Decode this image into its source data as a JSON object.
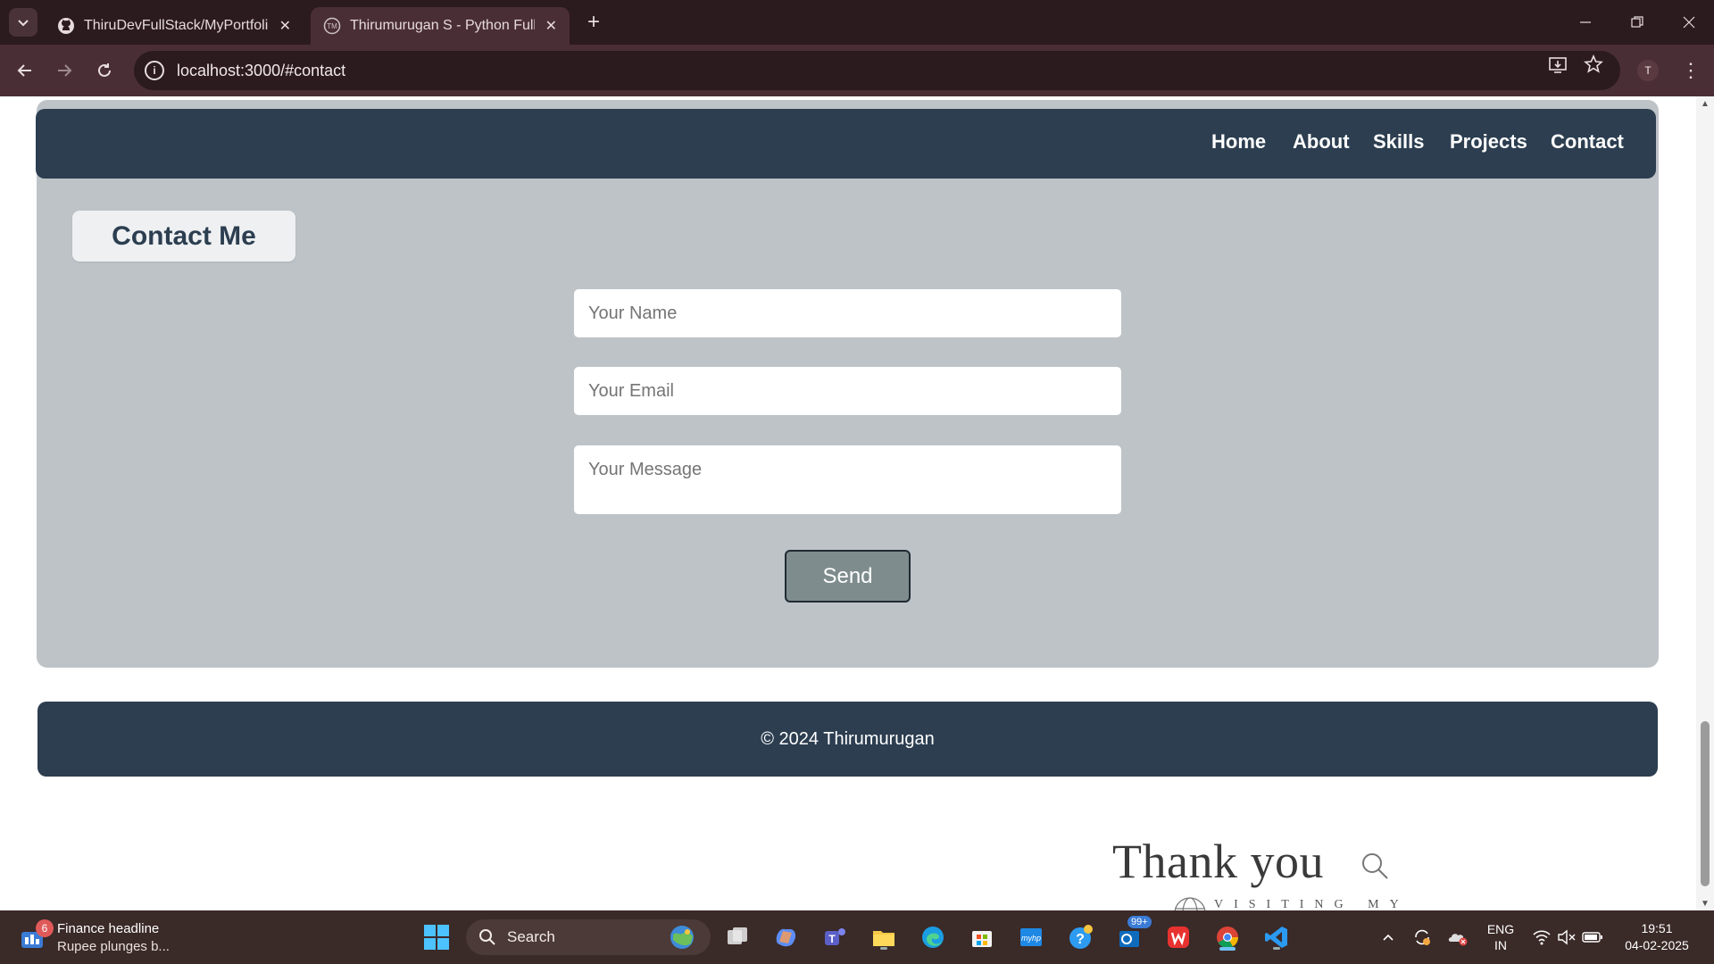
{
  "browser": {
    "tabs": [
      {
        "title": "ThiruDevFullStack/MyPortfolio-",
        "active": false
      },
      {
        "title": "Thirumurugan S - Python FullSt",
        "active": true
      }
    ],
    "url": "localhost:3000/#contact",
    "profile_initial": "T"
  },
  "navbar": {
    "links": [
      "Home",
      "About",
      "Skills",
      "Projects",
      "Contact"
    ]
  },
  "contact": {
    "heading": "Contact Me",
    "name_placeholder": "Your Name",
    "email_placeholder": "Your Email",
    "message_placeholder": "Your Message",
    "send_label": "Send"
  },
  "footer": {
    "text": "© 2024 Thirumurugan"
  },
  "bottom_image": {
    "thank_you": "Thank you",
    "visiting": "VISITING MY"
  },
  "taskbar": {
    "widget_title": "Finance headline",
    "widget_sub": "Rupee plunges b...",
    "widget_badge": "6",
    "search_label": "Search",
    "outlook_badge": "99+",
    "lang_top": "ENG",
    "lang_bottom": "IN",
    "time": "19:51",
    "date": "04-02-2025"
  },
  "colors": {
    "nav_bg": "#2c3e50",
    "section_bg": "#bdc3c7",
    "send_bg": "#7f8c8d",
    "chrome_dark": "#2b1a1e",
    "chrome_toolbar": "#4a2e36"
  }
}
